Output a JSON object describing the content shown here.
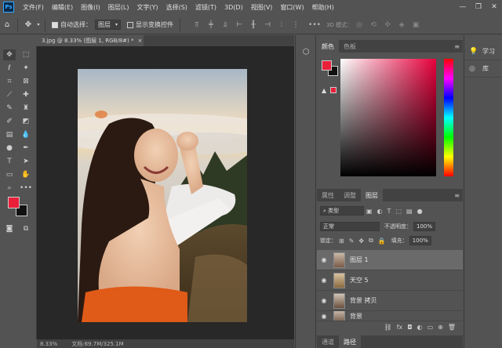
{
  "menu": {
    "app_icon": "Ps",
    "items": [
      "文件(F)",
      "编辑(E)",
      "图像(I)",
      "图层(L)",
      "文字(Y)",
      "选择(S)",
      "滤镜(T)",
      "3D(D)",
      "视图(V)",
      "窗口(W)",
      "帮助(H)"
    ],
    "window_controls": [
      "—",
      "❐",
      "✕"
    ]
  },
  "options": {
    "auto_select_label": "自动选择：",
    "auto_select_value": "图层",
    "show_transform_label": "显示变换控件",
    "mode_3d_label": "3D 模式："
  },
  "document": {
    "tab_label": "3.jpg @ 8.33% (图层 1, RGB/8#) *",
    "tab_close": "×"
  },
  "status": {
    "zoom": "8.33%",
    "doc_size": "文档:69.7M/325.1M"
  },
  "color_panel": {
    "tabs": [
      "颜色",
      "色板"
    ],
    "foreground": "#ea1f3a",
    "background": "#111111",
    "hue_color": "#e8003c"
  },
  "layers_panel": {
    "tabs": [
      "属性",
      "调整",
      "图层"
    ],
    "filter_label": "类型",
    "blend_mode": "正常",
    "opacity_label": "不透明度：",
    "opacity_value": "100%",
    "lock_label": "锁定：",
    "fill_label": "填充：",
    "fill_value": "100%",
    "layers": [
      {
        "name": "图层 1",
        "selected": true
      },
      {
        "name": "天空 5",
        "selected": false
      },
      {
        "name": "背景 拷贝",
        "selected": false
      },
      {
        "name": "背景",
        "selected": false
      }
    ]
  },
  "bottom_tabs": [
    "通道",
    "路径"
  ],
  "side_panels": {
    "learn": "学习",
    "library": "库"
  }
}
